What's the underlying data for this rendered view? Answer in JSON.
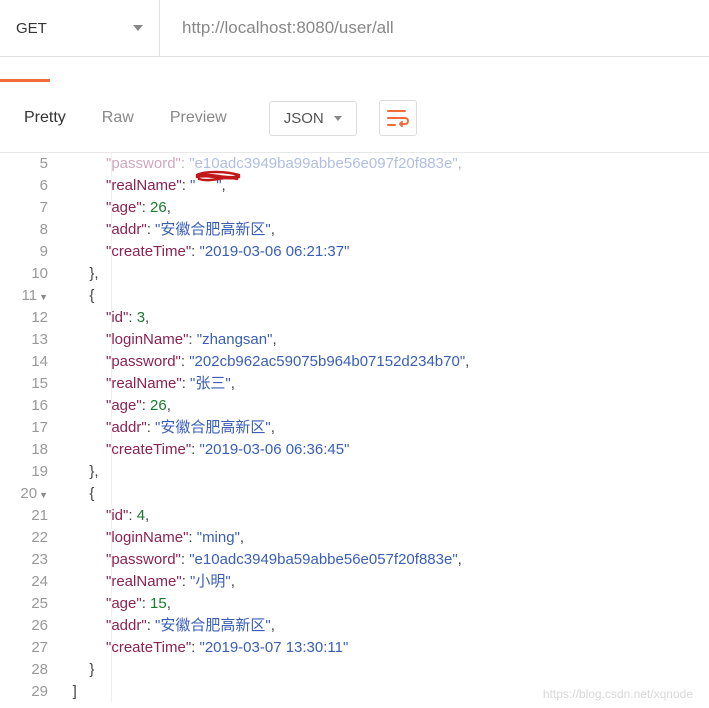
{
  "request": {
    "method": "GET",
    "url": "http://localhost:8080/user/all"
  },
  "tabs": {
    "pretty": "Pretty",
    "raw": "Raw",
    "preview": "Preview"
  },
  "format": {
    "label": "JSON"
  },
  "lines": [
    5,
    6,
    7,
    8,
    9,
    10,
    11,
    12,
    13,
    14,
    15,
    16,
    17,
    18,
    19,
    20,
    21,
    22,
    23,
    24,
    25,
    26,
    27,
    28,
    29
  ],
  "foldable": {
    "11": true,
    "20": true
  },
  "code": {
    "l5_k": "password",
    "l5_v": "e10adc3949ba99abbe56e097f20f883e",
    "l6_k": "realName",
    "l7_k": "age",
    "l7_v": 26,
    "l8_k": "addr",
    "l8_v": "安徽合肥高新区",
    "l9_k": "createTime",
    "l9_v": "2019-03-06 06:21:37",
    "l12_k": "id",
    "l12_v": 3,
    "l13_k": "loginName",
    "l13_v": "zhangsan",
    "l14_k": "password",
    "l14_v": "202cb962ac59075b964b07152d234b70",
    "l15_k": "realName",
    "l15_v": "张三",
    "l16_k": "age",
    "l16_v": 26,
    "l17_k": "addr",
    "l17_v": "安徽合肥高新区",
    "l18_k": "createTime",
    "l18_v": "2019-03-06 06:36:45",
    "l21_k": "id",
    "l21_v": 4,
    "l22_k": "loginName",
    "l22_v": "ming",
    "l23_k": "password",
    "l23_v": "e10adc3949ba59abbe56e057f20f883e",
    "l24_k": "realName",
    "l24_v": "小明",
    "l25_k": "age",
    "l25_v": 15,
    "l26_k": "addr",
    "l26_v": "安徽合肥高新区",
    "l27_k": "createTime",
    "l27_v": "2019-03-07 13:30:11"
  },
  "watermark": "https://blog.csdn.net/xqnode"
}
